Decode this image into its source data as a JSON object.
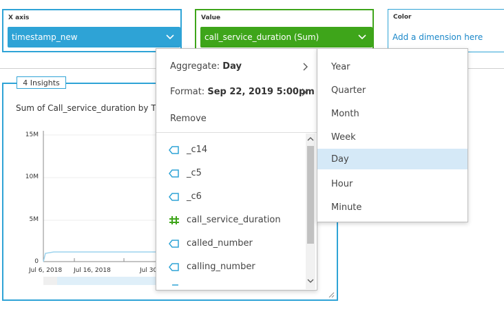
{
  "field_wells": {
    "x_axis": {
      "title": "X axis",
      "field": "timestamp_new"
    },
    "value": {
      "title": "Value",
      "field": "call_service_duration (Sum)"
    },
    "color": {
      "title": "Color",
      "placeholder": "Add a dimension here"
    }
  },
  "visual": {
    "insights_badge": "4 Insights",
    "title": "Sum of Call_service_duration by T",
    "y_ticks": [
      "15M",
      "10M",
      "5M",
      "0"
    ],
    "x_ticks": [
      "Jul 6, 2018",
      "Jul 16, 2018",
      "Jul 30"
    ]
  },
  "menu": {
    "aggregate": {
      "label": "Aggregate:",
      "value": "Day"
    },
    "format": {
      "label": "Format:",
      "value": "Sep 22, 2019 5:00pm"
    },
    "remove_label": "Remove",
    "fields": [
      {
        "name": "_c14",
        "icon": "dimension-tag-icon"
      },
      {
        "name": "_c5",
        "icon": "dimension-tag-icon"
      },
      {
        "name": "_c6",
        "icon": "dimension-tag-icon"
      },
      {
        "name": "call_service_duration",
        "icon": "measure-hash-icon"
      },
      {
        "name": "called_number",
        "icon": "dimension-tag-icon"
      },
      {
        "name": "calling_number",
        "icon": "dimension-tag-icon"
      }
    ]
  },
  "aggregate_submenu": {
    "selected": "Day",
    "items": [
      "Year",
      "Quarter",
      "Month",
      "Week",
      "Day",
      "Hour",
      "Minute"
    ]
  },
  "colors": {
    "well_border": "#2ea3d6",
    "x_pill": "#2ea3d6",
    "value_pill": "#3ea51a",
    "value_border": "#3ea51a",
    "selected_bg": "#d5e9f7",
    "dimension_icon": "#2ea3d6",
    "measure_icon": "#3ea51a"
  }
}
